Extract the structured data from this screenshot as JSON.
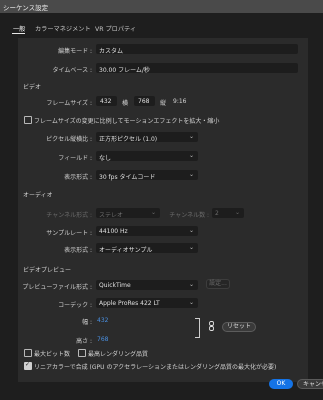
{
  "window": {
    "title": "シーケンス設定"
  },
  "tabs": [
    {
      "label": "一般"
    },
    {
      "label": "カラーマネジメント"
    },
    {
      "label": "VR プロパティ"
    }
  ],
  "general": {
    "edit_mode_label": "編集モード :",
    "edit_mode_value": "カスタム",
    "timebase_label": "タイムベース :",
    "timebase_value": "30.00 フレーム/秒"
  },
  "video": {
    "section_title": "ビデオ",
    "frame_size_label": "フレームサイズ :",
    "frame_width": "432",
    "width_label": "横",
    "frame_height": "768",
    "height_label": "縦",
    "aspect": "9:16",
    "scale_checkbox_label": "フレームサイズの変更に比例してモーションエフェクトを拡大・縮小",
    "pixel_aspect_label": "ピクセル縦横比 :",
    "pixel_aspect_value": "正方形ピクセル (1.0)",
    "fields_label": "フィールド :",
    "fields_value": "なし",
    "display_format_label": "表示形式 :",
    "display_format_value": "30 fps タイムコード"
  },
  "audio": {
    "section_title": "オーディオ",
    "channel_format_label": "チャンネル形式 :",
    "channel_format_value": "ステレオ",
    "channel_count_label": "チャンネル数 :",
    "channel_count_value": "2",
    "sample_rate_label": "サンプルレート :",
    "sample_rate_value": "44100 Hz",
    "display_format_label": "表示形式 :",
    "display_format_value": "オーディオサンプル"
  },
  "preview": {
    "section_title": "ビデオプレビュー",
    "file_format_label": "プレビューファイル形式 :",
    "file_format_value": "QuickTime",
    "settings_button": "設定...",
    "codec_label": "コーデック :",
    "codec_value": "Apple ProRes 422 LT",
    "width_label": "幅 :",
    "width_value": "432",
    "height_label": "高さ :",
    "height_value": "768",
    "reset_button": "リセット"
  },
  "options": {
    "max_bit_depth": "最大ビット数",
    "max_render_quality": "最高レンダリング品質",
    "linear_color": "リニアカラーで合成 (GPU のアクセラレーションまたはレンダリング品質の最大化が必要)"
  },
  "footer": {
    "ok": "OK",
    "cancel": "キャンセル"
  },
  "colors": {
    "accent": "#1473e6",
    "link": "#4a90e2"
  }
}
